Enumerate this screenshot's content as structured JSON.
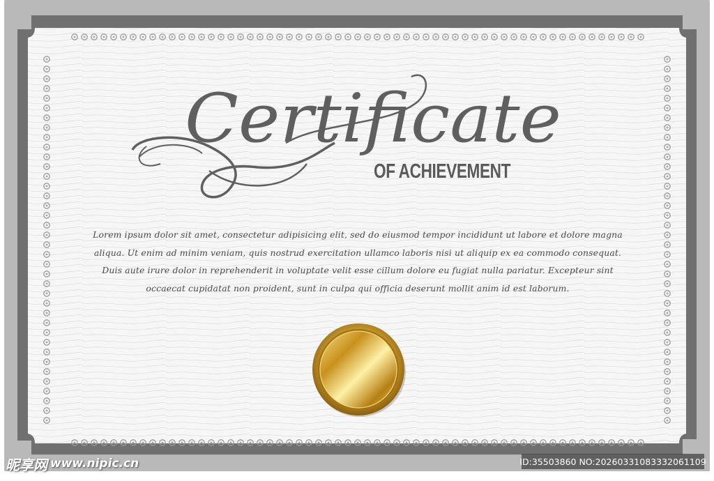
{
  "certificate": {
    "title": "Certificate",
    "subtitle": "OF ACHIEVEMENT",
    "body_lines": [
      "Lorem ipsum dolor sit amet, consectetur adipisicing elit, sed do eiusmod tempor incididunt ut labore et dolore magna",
      "aliqua. Ut enim ad minim veniam, quis nostrud exercitation ullamco laboris nisi ut aliquip ex ea commodo consequat.",
      "Duis aute irure dolor in reprehenderit in voluptate velit esse cillum dolore eu fugiat nulla pariatur. Excepteur sint",
      "occaecat cupidatat non proident, sunt in culpa qui officia deserunt mollit anim id est laborum."
    ],
    "seal": "gold-seal-icon"
  },
  "watermark": {
    "brand": "昵享网",
    "url": "www.nipic.cn",
    "id_text": "ID:35503860 NO:20260331083332061109"
  },
  "colors": {
    "frame": "#b9b9b9",
    "frame_dark": "#6e6e6e",
    "paper": "#f7f7f7",
    "title": "#5f5f5f",
    "gold": "#d4a73a"
  }
}
